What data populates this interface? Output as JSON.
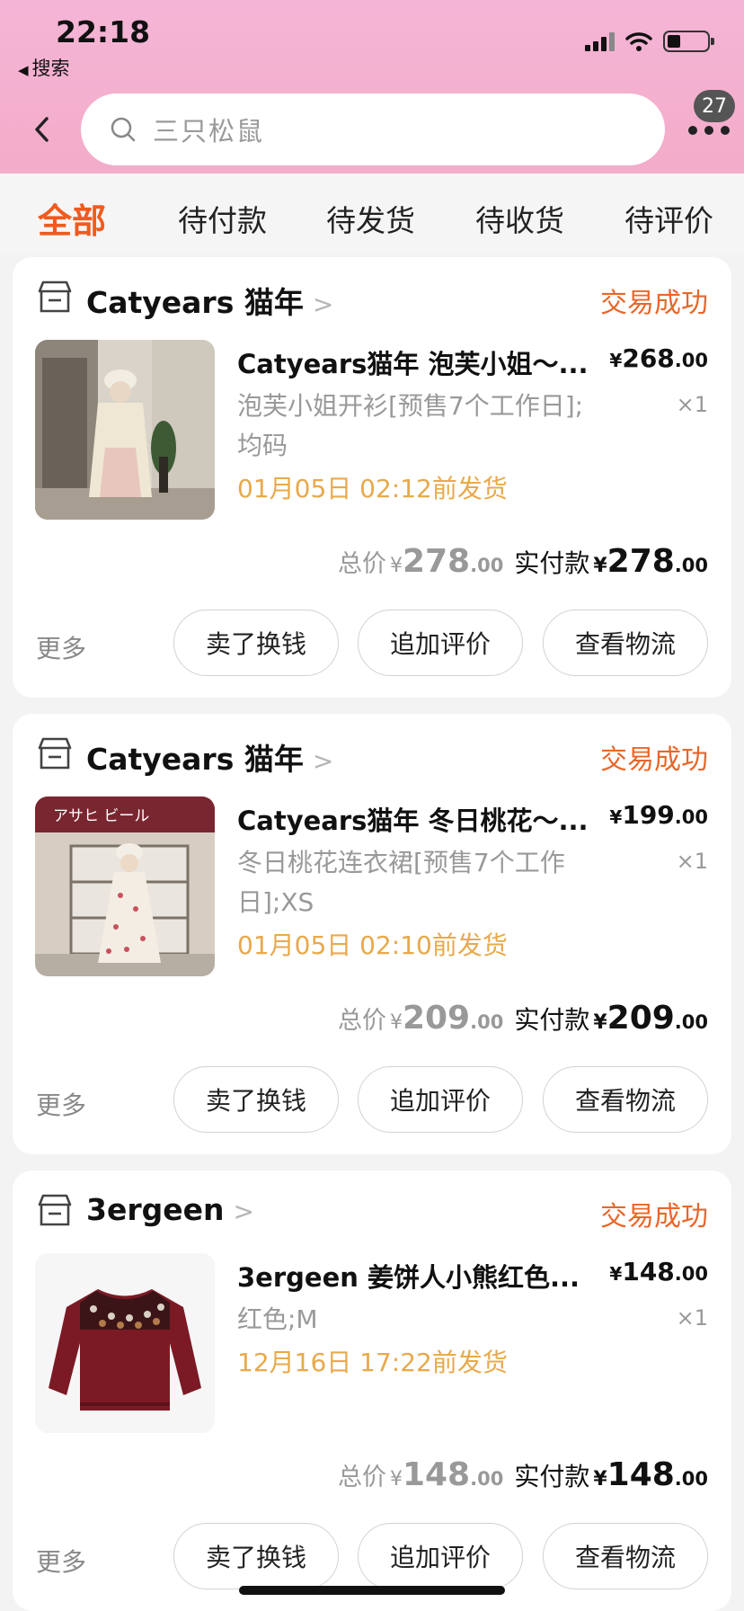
{
  "status_bar": {
    "time": "22:18",
    "back_app": "搜索"
  },
  "search": {
    "placeholder": "三只松鼠"
  },
  "more_badge": "27",
  "tabs": [
    "全部",
    "待付款",
    "待发货",
    "待收货",
    "待评价"
  ],
  "orders": [
    {
      "shop": "Catyears 猫年",
      "status": "交易成功",
      "title": "Catyears猫年 泡芙小姐～...",
      "price_yen": "¥",
      "price_int": "268",
      "price_dec": ".00",
      "spec": "泡芙小姐开衫[预售7个工作日];均码",
      "qty": "×1",
      "ship": "01月05日 02:12前发货",
      "total_label": "总价",
      "total_yen": "¥",
      "total_int": "278",
      "total_dec": ".00",
      "paid_label": "实付款",
      "paid_yen": "¥",
      "paid_int": "278",
      "paid_dec": ".00",
      "more": "更多",
      "buttons": [
        "卖了换钱",
        "追加评价",
        "查看物流"
      ]
    },
    {
      "shop": "Catyears 猫年",
      "status": "交易成功",
      "title": "Catyears猫年 冬日桃花～...",
      "price_yen": "¥",
      "price_int": "199",
      "price_dec": ".00",
      "spec": "冬日桃花连衣裙[预售7个工作日];XS",
      "qty": "×1",
      "ship": "01月05日 02:10前发货",
      "total_label": "总价",
      "total_yen": "¥",
      "total_int": "209",
      "total_dec": ".00",
      "paid_label": "实付款",
      "paid_yen": "¥",
      "paid_int": "209",
      "paid_dec": ".00",
      "more": "更多",
      "buttons": [
        "卖了换钱",
        "追加评价",
        "查看物流"
      ],
      "sign_text": "アサヒ ビール"
    },
    {
      "shop": "3ergeen",
      "status": "交易成功",
      "title": "3ergeen 姜饼人小熊红色...",
      "price_yen": "¥",
      "price_int": "148",
      "price_dec": ".00",
      "spec": "红色;M",
      "qty": "×1",
      "ship": "12月16日 17:22前发货",
      "total_label": "总价",
      "total_yen": "¥",
      "total_int": "148",
      "total_dec": ".00",
      "paid_label": "实付款",
      "paid_yen": "¥",
      "paid_int": "148",
      "paid_dec": ".00",
      "more": "更多",
      "buttons": [
        "卖了换钱",
        "追加评价",
        "查看物流"
      ]
    }
  ],
  "colors": {
    "header_pink": "#f3acc9",
    "accent_orange": "#f05a1e",
    "status_orange": "#e8672a",
    "ship_gold": "#e8a94c"
  },
  "icons": [
    "search-icon",
    "back-arrow-icon",
    "more-dots-icon",
    "shop-icon",
    "chevron-right-icon",
    "signal-icon",
    "wifi-icon",
    "battery-icon"
  ]
}
